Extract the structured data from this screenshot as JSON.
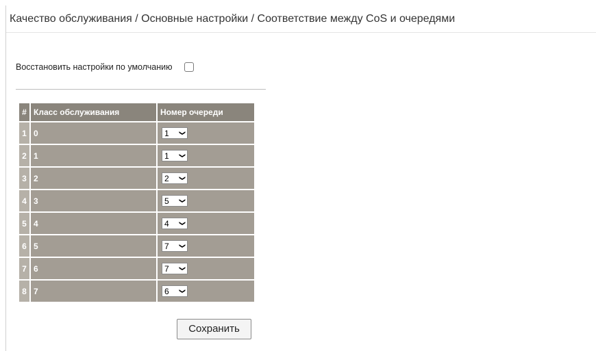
{
  "page": {
    "title": "Качество обслуживания / Основные настройки / Соответствие между CoS и очередями"
  },
  "restore": {
    "label": "Восстановить настройки по умолчанию",
    "checked": false
  },
  "table": {
    "headers": [
      "#",
      "Класс обслуживания",
      "Номер очереди"
    ],
    "rows": [
      {
        "index": "1",
        "cos": "0",
        "queue": "1"
      },
      {
        "index": "2",
        "cos": "1",
        "queue": "1"
      },
      {
        "index": "3",
        "cos": "2",
        "queue": "2"
      },
      {
        "index": "4",
        "cos": "3",
        "queue": "5"
      },
      {
        "index": "5",
        "cos": "4",
        "queue": "4"
      },
      {
        "index": "6",
        "cos": "5",
        "queue": "7"
      },
      {
        "index": "7",
        "cos": "6",
        "queue": "7"
      },
      {
        "index": "8",
        "cos": "7",
        "queue": "6"
      }
    ]
  },
  "actions": {
    "save_label": "Сохранить"
  },
  "icons": {
    "dropdown": "chevron-down-icon"
  }
}
